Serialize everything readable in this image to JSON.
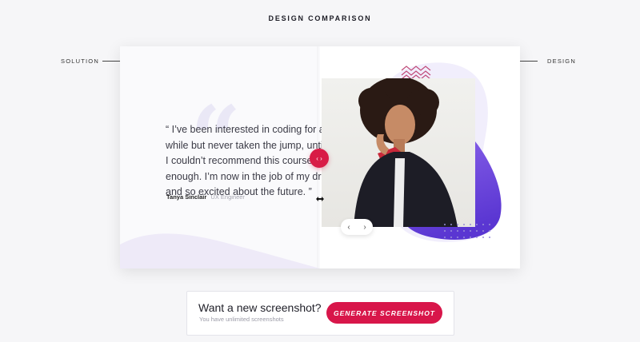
{
  "header": {
    "title": "DESIGN COMPARISON"
  },
  "labels": {
    "left": "SOLUTION",
    "right": "DESIGN"
  },
  "testimonial": {
    "quote": "“ I’ve been interested in coding for a while but never taken the jump, until now. I couldn’t recommend this course enough. I’m now in the job of my dreams and so excited about the future. ”",
    "author_name": "Tanya Sinclair",
    "author_role": "UX Engineer"
  },
  "carousel": {
    "prev_glyph": "‹",
    "next_glyph": "›"
  },
  "compare_handle": {
    "glyph": "‹ ›"
  },
  "cta": {
    "title": "Want a new screenshot?",
    "subtitle": "You have unlimited screenshots",
    "button_label": "GENERATE SCREENSHOT"
  },
  "colors": {
    "accent": "#d8164a",
    "purple": "#6a3ee0",
    "text": "#3b3b46"
  }
}
